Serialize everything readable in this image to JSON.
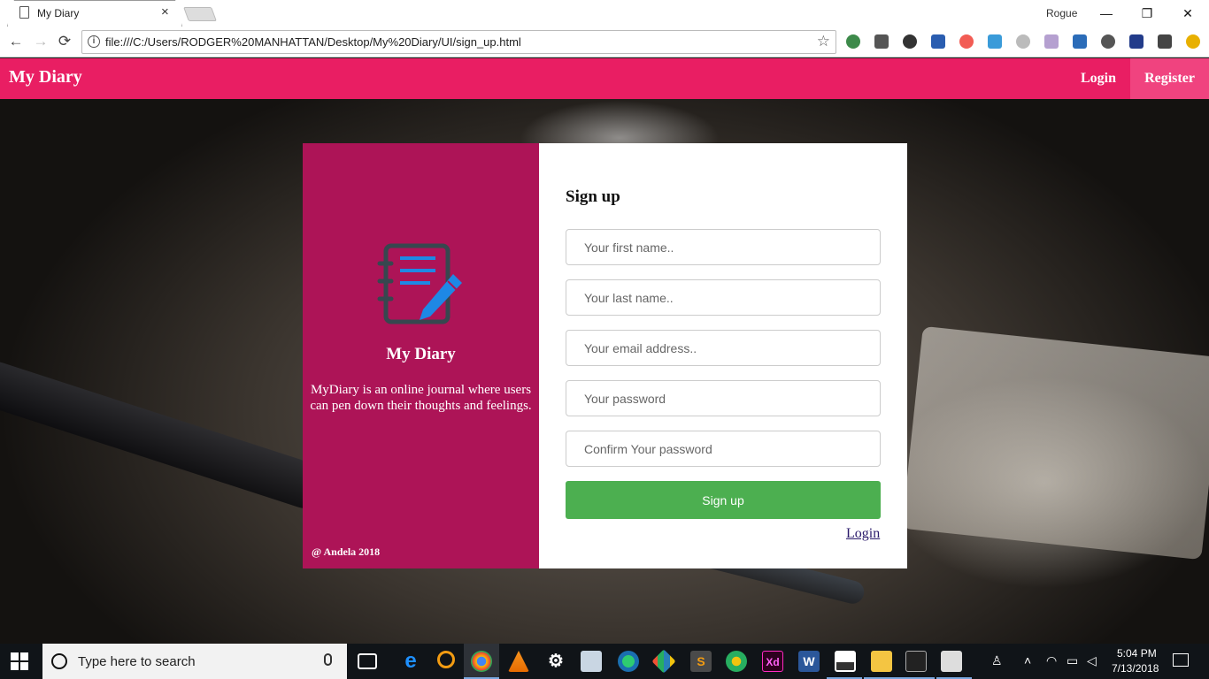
{
  "browser": {
    "tab_title": "My Diary",
    "tab_close": "×",
    "profile_name": "Rogue",
    "url": "file:///C:/Users/RODGER%20MANHATTAN/Desktop/My%20Diary/UI/sign_up.html",
    "window_controls": {
      "minimize": "—",
      "restore": "❐",
      "close": "✕"
    },
    "nav": {
      "back": "←",
      "forward": "→",
      "reload": "⟳"
    },
    "info_glyph": "i",
    "star_glyph": "☆",
    "extension_icons": [
      "globe-icon",
      "bus-icon",
      "puzzle-icon",
      "gmail-icon",
      "cancel-icon",
      "image-icon",
      "medium-icon",
      "pdf-icon",
      "download-manager-icon",
      "settings-ext-icon",
      "bookmark-icon",
      "download-icon",
      "alert-icon"
    ]
  },
  "navbar": {
    "brand": "My Diary",
    "login": "Login",
    "register": "Register",
    "bg_color": "#e91e63",
    "active_color": "#f0437f"
  },
  "info_panel": {
    "title": "My Diary",
    "description": "MyDiary is an online journal where users can pen down their thoughts and feelings.",
    "footer": "@ Andela 2018",
    "bg_color": "#ad1457",
    "logo_icon": "notebook-pen-icon"
  },
  "signup_form": {
    "title": "Sign up",
    "fields": {
      "first_name": "Your first name..",
      "last_name": "Your last name..",
      "email": "Your email address..",
      "password": "Your password",
      "confirm_password": "Confirm Your password"
    },
    "submit_label": "Sign up",
    "submit_color": "#4caf50",
    "login_link": "Login"
  },
  "taskbar": {
    "search_placeholder": "Type here to search",
    "time": "5:04 PM",
    "date": "7/13/2018",
    "apps": [
      "task-view-icon",
      "edge-icon",
      "search-app-icon",
      "chrome-icon",
      "vlc-icon",
      "settings-icon",
      "photos-icon",
      "maps-icon",
      "git-icon",
      "sublime-icon",
      "snail-icon",
      "xd-icon",
      "word-icon",
      "image-viewer-icon",
      "file-explorer-icon",
      "terminal-icon",
      "remote-desktop-icon"
    ],
    "xd_label": "Xd",
    "word_label": "W"
  }
}
